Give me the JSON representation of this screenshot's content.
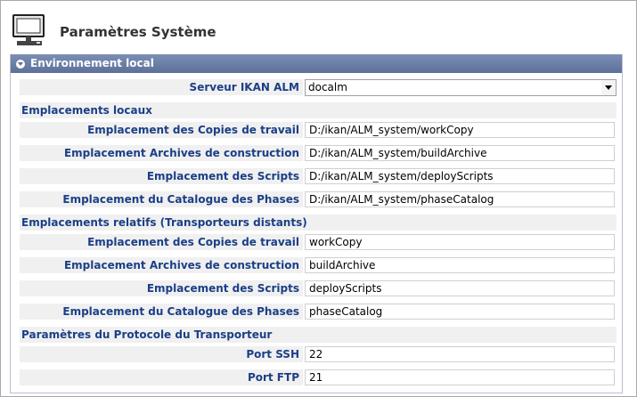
{
  "page": {
    "title": "Paramètres Système"
  },
  "panel": {
    "title": "Environnement local"
  },
  "server": {
    "label": "Serveur IKAN ALM",
    "selected": "docalm"
  },
  "local": {
    "heading": "Emplacements locaux",
    "rows": [
      {
        "label": "Emplacement des Copies de travail",
        "value": "D:/ikan/ALM_system/workCopy"
      },
      {
        "label": "Emplacement Archives de construction",
        "value": "D:/ikan/ALM_system/buildArchive"
      },
      {
        "label": "Emplacement des Scripts",
        "value": "D:/ikan/ALM_system/deployScripts"
      },
      {
        "label": "Emplacement du Catalogue des Phases",
        "value": "D:/ikan/ALM_system/phaseCatalog"
      }
    ]
  },
  "relative": {
    "heading": "Emplacements relatifs (Transporteurs distants)",
    "rows": [
      {
        "label": "Emplacement des Copies de travail",
        "value": "workCopy"
      },
      {
        "label": "Emplacement Archives de construction",
        "value": "buildArchive"
      },
      {
        "label": "Emplacement des Scripts",
        "value": "deployScripts"
      },
      {
        "label": "Emplacement du Catalogue des Phases",
        "value": "phaseCatalog"
      }
    ]
  },
  "protocol": {
    "heading": "Paramètres du Protocole du Transporteur",
    "rows": [
      {
        "label": "Port SSH",
        "value": "22"
      },
      {
        "label": "Port FTP",
        "value": "21"
      }
    ]
  }
}
